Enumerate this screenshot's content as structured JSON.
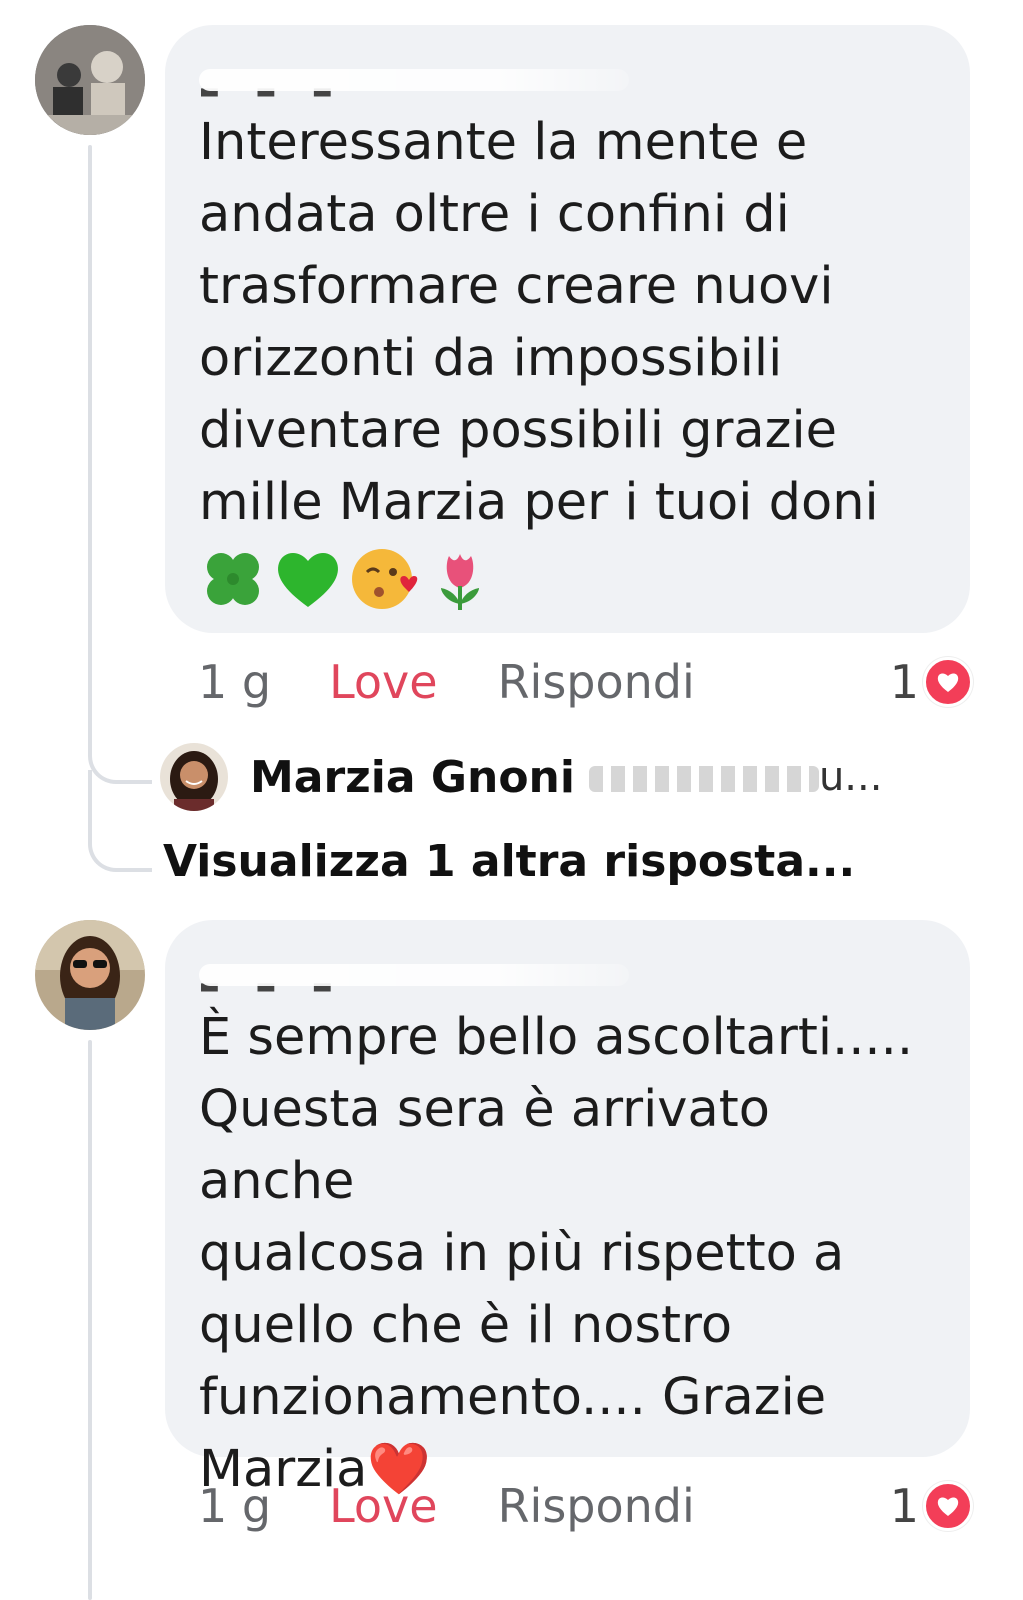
{
  "comments": [
    {
      "text": "Interessante la mente e\nandata oltre i confini di\ntrasformare creare nuovi\norizzonti da impossibili\ndiventare possibili grazie\nmille Marzia per i tuoi doni",
      "emojis": [
        "🍀",
        "💚",
        "😘",
        "🌷"
      ],
      "time": "1 g",
      "reaction_label": "Love",
      "reply_label": "Rispondi",
      "reaction_count": "1"
    },
    {
      "text": "È sempre bello ascoltarti.....\nQuesta sera è arrivato anche\nqualcosa in più rispetto a\nquello che è il nostro\nfunzionamento.... Grazie\nMarzia❤️",
      "time": "1 g",
      "reaction_label": "Love",
      "reply_label": "Rispondi",
      "reaction_count": "1"
    }
  ],
  "reply_preview": {
    "name": "Marzia Gnoni",
    "preview_end": "u..."
  },
  "more_replies_label": "Visualizza 1 altra risposta...",
  "colors": {
    "bubble": "#f0f2f5",
    "love": "#e0465c",
    "meta": "#65676b",
    "love_badge": "#f33e58"
  }
}
